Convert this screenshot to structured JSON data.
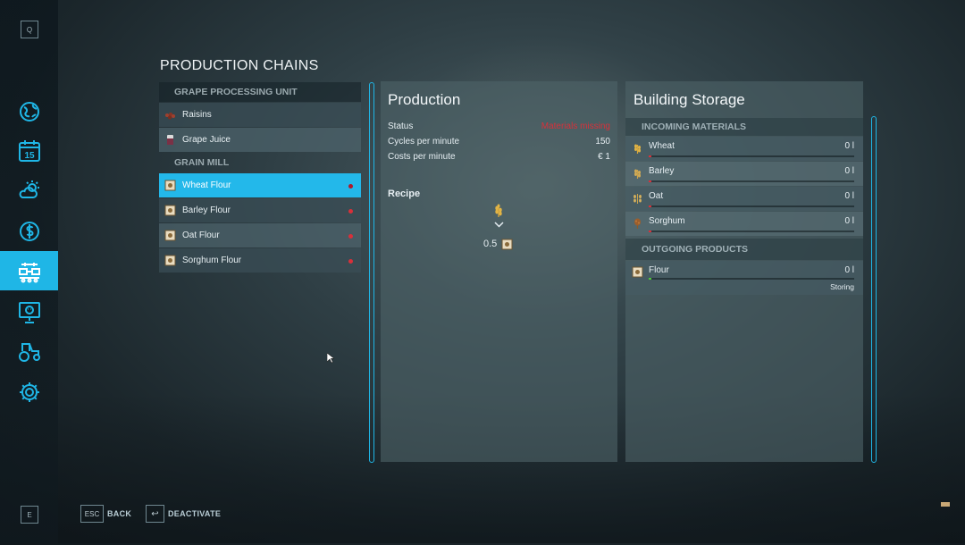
{
  "sidebar": {
    "top_key": "Q",
    "bottom_key": "E",
    "items": [
      {
        "icon": "globe-map-icon",
        "active": false
      },
      {
        "icon": "calendar-icon",
        "label": "15",
        "active": false
      },
      {
        "icon": "weather-icon",
        "active": false
      },
      {
        "icon": "finances-icon",
        "active": false
      },
      {
        "icon": "production-chains-icon",
        "active": true
      },
      {
        "icon": "animals-icon",
        "active": false
      },
      {
        "icon": "vehicles-icon",
        "active": false
      },
      {
        "icon": "settings-gear-icon",
        "active": false
      }
    ]
  },
  "page": {
    "title": "PRODUCTION CHAINS"
  },
  "chains": {
    "groups": [
      {
        "name": "GRAPE PROCESSING UNIT",
        "items": [
          {
            "label": "Raisins",
            "icon": "raisins-icon",
            "alert": false
          },
          {
            "label": "Grape Juice",
            "icon": "grape-juice-icon",
            "alert": false
          }
        ]
      },
      {
        "name": "GRAIN MILL",
        "items": [
          {
            "label": "Wheat Flour",
            "icon": "flour-sack-icon",
            "alert": true,
            "selected": true
          },
          {
            "label": "Barley Flour",
            "icon": "flour-sack-icon",
            "alert": true
          },
          {
            "label": "Oat Flour",
            "icon": "flour-sack-icon",
            "alert": true
          },
          {
            "label": "Sorghum Flour",
            "icon": "flour-sack-icon",
            "alert": true
          }
        ]
      }
    ]
  },
  "production": {
    "title": "Production",
    "status_label": "Status",
    "status_value": "Materials missing",
    "cycles_label": "Cycles per minute",
    "cycles_value": "150",
    "costs_label": "Costs per minute",
    "costs_value": "€ 1",
    "recipe_label": "Recipe",
    "recipe_output_amount": "0.5"
  },
  "storage": {
    "title": "Building Storage",
    "incoming_header": "INCOMING MATERIALS",
    "outgoing_header": "OUTGOING PRODUCTS",
    "incoming": [
      {
        "name": "Wheat",
        "amount": "0 l",
        "icon": "wheat-icon",
        "fill": 0
      },
      {
        "name": "Barley",
        "amount": "0 l",
        "icon": "barley-icon",
        "fill": 0
      },
      {
        "name": "Oat",
        "amount": "0 l",
        "icon": "oat-icon",
        "fill": 0
      },
      {
        "name": "Sorghum",
        "amount": "0 l",
        "icon": "sorghum-icon",
        "fill": 0
      }
    ],
    "outgoing": [
      {
        "name": "Flour",
        "amount": "0 l",
        "icon": "flour-sack-icon",
        "mode": "Storing",
        "fill": 0
      }
    ]
  },
  "footer": {
    "back_key": "ESC",
    "back_label": "BACK",
    "deactivate_key": "↩",
    "deactivate_label": "DEACTIVATE"
  },
  "colors": {
    "accent": "#1fb6e6",
    "alert": "#d8303a",
    "panel": "#4e6268"
  }
}
